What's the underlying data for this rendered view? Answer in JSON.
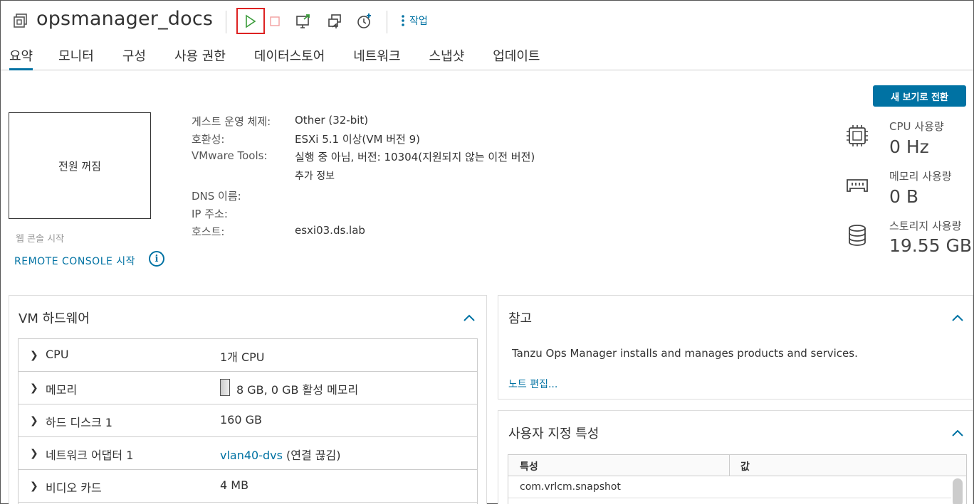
{
  "header": {
    "vm_name": "opsmanager_docs",
    "actions_label": "작업"
  },
  "tabs": [
    {
      "label": "요약",
      "active": true
    },
    {
      "label": "모니터"
    },
    {
      "label": "구성"
    },
    {
      "label": "사용 권한"
    },
    {
      "label": "데이터스토어"
    },
    {
      "label": "네트워크"
    },
    {
      "label": "스냅샷"
    },
    {
      "label": "업데이트"
    }
  ],
  "console": {
    "power_state": "전원 꺼짐",
    "web_console": "웹 콘솔 시작",
    "remote_console": "REMOTE CONSOLE 시작",
    "info_glyph": "i"
  },
  "guest": {
    "os_label": "게스트 운영 체제:",
    "os_value": "Other (32-bit)",
    "compat_label": "호환성:",
    "compat_value": "ESXi 5.1 이상(VM 버전 9)",
    "tools_label": "VMware Tools:",
    "tools_value": "실행 중 아님, 버전: 10304(지원되지 않는 이전 버전)",
    "more_info": "추가 정보",
    "dns_label": "DNS 이름:",
    "ip_label": "IP 주소:",
    "host_label": "호스트:",
    "host_value": "esxi03.ds.lab"
  },
  "new_view_button": "새 보기로 전환",
  "metrics": {
    "cpu_label": "CPU 사용량",
    "cpu_value": "0 Hz",
    "mem_label": "메모리 사용량",
    "mem_value": "0 B",
    "storage_label": "스토리지 사용량",
    "storage_value": "19.55 GB"
  },
  "hardware": {
    "title": "VM 하드웨어",
    "rows": [
      {
        "name": "CPU",
        "value": "1개 CPU"
      },
      {
        "name": "메모리",
        "value": "8 GB, 0 GB 활성 메모리"
      },
      {
        "name": "하드 디스크 1",
        "value": "160 GB"
      },
      {
        "name": "네트워크 어댑터 1",
        "value_link": "vlan40-dvs",
        "value_suffix": " (연결 끊김)"
      },
      {
        "name": "비디오 카드",
        "value": "4 MB"
      }
    ]
  },
  "notes": {
    "title": "참고",
    "text": "Tanzu Ops Manager installs and manages products and services.",
    "edit_link": "노트 편집..."
  },
  "custom_attrs": {
    "title": "사용자 지정 특성",
    "col_attr": "특성",
    "col_value": "값",
    "rows": [
      {
        "attr": "com.vrlcm.snapshot",
        "value": ""
      }
    ]
  },
  "colors": {
    "accent": "#0072a3",
    "highlight_border": "#dd2222",
    "play_green": "#3a9c3a"
  }
}
